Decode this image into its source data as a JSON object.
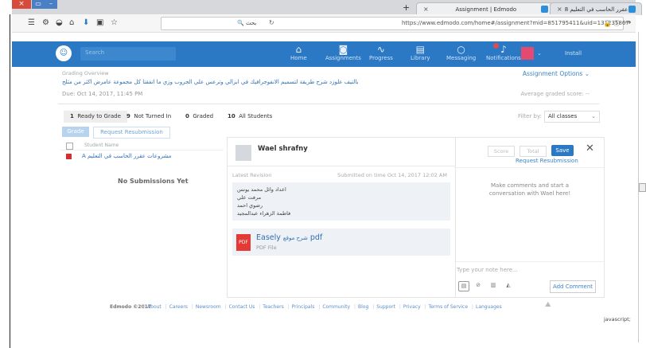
{
  "browser": {
    "tabs": [
      {
        "title": "Assignment | Edmodo"
      },
      {
        "title": "روضات عقرر الحاسب في التعليم 8"
      }
    ],
    "url_search_text": "بحث",
    "url": "https://www.edmodo.com/home#/assignment?mid=851795411&uid=131235867",
    "url_host": "edmodo.com",
    "status": "javascript;"
  },
  "header": {
    "search_placeholder": "Search",
    "nav": [
      {
        "label": "Home",
        "icon": "home-icon"
      },
      {
        "label": "Assignments",
        "icon": "camera-icon"
      },
      {
        "label": "Progress",
        "icon": "pulse-icon"
      },
      {
        "label": "Library",
        "icon": "library-icon"
      },
      {
        "label": "Messaging",
        "icon": "chat-icon"
      },
      {
        "label": "Notifications",
        "icon": "bell-icon"
      }
    ],
    "user_name": "Install"
  },
  "overview": {
    "label": "Grading Overview",
    "title": "بالتيف علوزد شرح طريقة لتسميم الانفوجرافيك في ابزالي وترعس علي الجروب وزي ما اتفقنا كل مجموعة عامرض اكثر من مثلح",
    "due": "Due: Oct 14, 2017, 11:45 PM",
    "options_label": "Assignment Options",
    "avg_score_label": "Average graded score: --"
  },
  "status_tabs": [
    {
      "count": "1",
      "label": "Ready to Grade"
    },
    {
      "count": "9",
      "label": "Not Turned In"
    },
    {
      "count": "0",
      "label": "Graded"
    },
    {
      "count": "10",
      "label": "All Students"
    }
  ],
  "filter": {
    "label": "Filter by:",
    "value": "All classes"
  },
  "subtabs": {
    "grade": "Grade",
    "request": "Request Resubmission"
  },
  "student_list": {
    "header": "Student Name",
    "group": "مشروعات عقرر الحاسب في التعليم A",
    "empty": "No Submissions Yet"
  },
  "submission": {
    "student": "Wael shrafny",
    "latest_revision": "Latest Revision",
    "submitted": "Submitted on time Oct 14, 2017 12:02 AM",
    "members": [
      "اعداد وائل محمد يونس",
      "مرفت علي",
      "رضوي احمد",
      "فاطمة الزهراء عبدالمجيد"
    ],
    "file_name_en": "Easely",
    "file_name_ar": "شرح موقع",
    "file_ext": "pdf",
    "file_type": "PDF File",
    "file_icon_text": "PDF"
  },
  "grading": {
    "score_placeholder": "Score",
    "total_placeholder": "Total",
    "save": "Save",
    "request_resubmission": "Request Resubmission",
    "comment_prompt": "Make comments and start a conversation with Wael here!",
    "note_placeholder": "Type your note here...",
    "add_comment": "Add Comment"
  },
  "footer": {
    "copyright": "Edmodo ©2017",
    "links": [
      "About",
      "Careers",
      "Newsroom",
      "Contact Us",
      "Teachers",
      "Principals",
      "Community",
      "Blog",
      "Support",
      "Privacy",
      "Terms of Service",
      "Languages"
    ]
  },
  "colors": {
    "brand": "#2b78c5",
    "accent_red": "#d92c2c"
  }
}
